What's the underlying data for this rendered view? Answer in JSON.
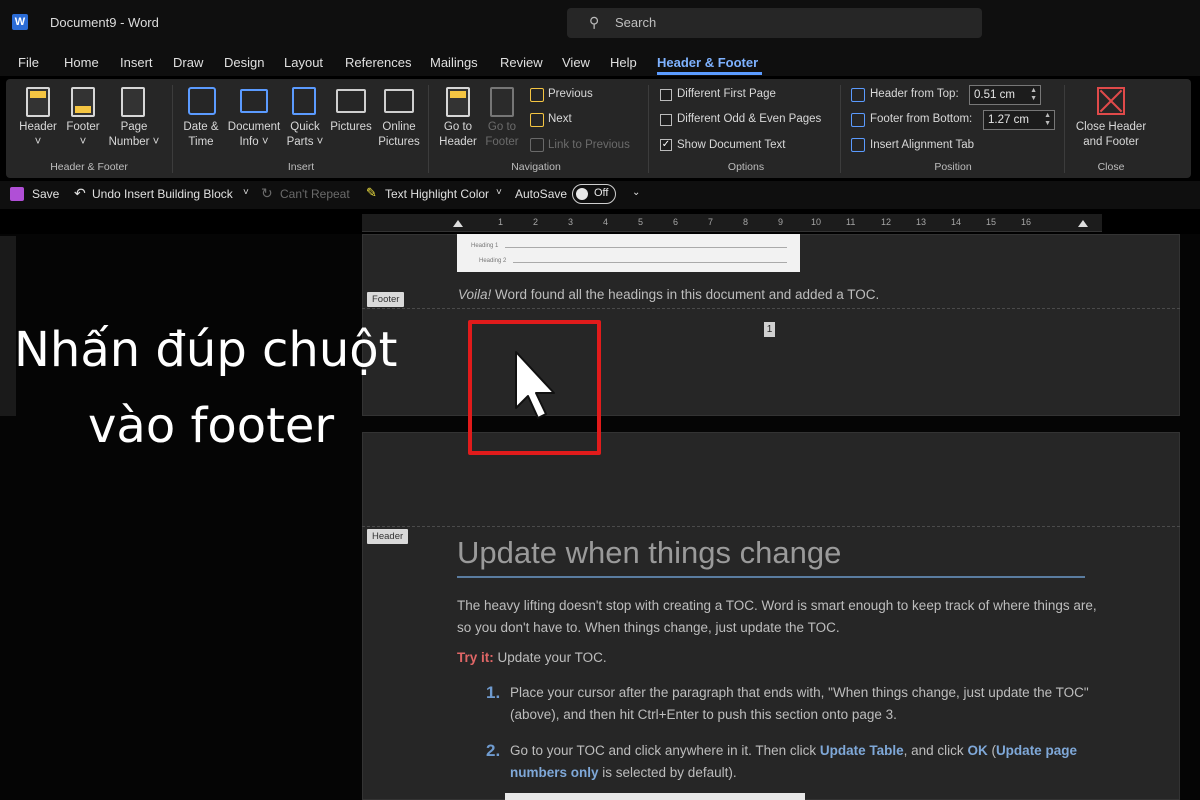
{
  "titlebar": {
    "doc_title": "Document9 - Word",
    "search_placeholder": "Search"
  },
  "menu_tabs": [
    "File",
    "Home",
    "Insert",
    "Draw",
    "Design",
    "Layout",
    "References",
    "Mailings",
    "Review",
    "View",
    "Help",
    "Header & Footer"
  ],
  "active_tab": "Header & Footer",
  "ribbon": {
    "header_footer": {
      "header": "Header",
      "footer": "Footer",
      "page_number_1": "Page",
      "page_number_2": "Number",
      "group": "Header & Footer"
    },
    "insert": {
      "date_1": "Date &",
      "date_2": "Time",
      "docinfo_1": "Document",
      "docinfo_2": "Info",
      "quick_1": "Quick",
      "quick_2": "Parts",
      "pictures": "Pictures",
      "online_1": "Online",
      "online_2": "Pictures",
      "group": "Insert"
    },
    "navigation": {
      "goto_1": "Go to",
      "goto_2": "Header",
      "goto_footer_1": "Go to",
      "goto_footer_2": "Footer",
      "previous": "Previous",
      "next": "Next",
      "link": "Link to Previous",
      "group": "Navigation"
    },
    "options": {
      "diff_first": "Different First Page",
      "diff_odd_even": "Different Odd & Even Pages",
      "show_doc_text": "Show Document Text",
      "group": "Options"
    },
    "position": {
      "header_from_top": "Header from Top:",
      "header_value": "0.51 cm",
      "footer_from_bottom": "Footer from Bottom:",
      "footer_value": "1.27 cm",
      "insert_tab": "Insert Alignment Tab",
      "group": "Position"
    },
    "close": {
      "label_1": "Close Header",
      "label_2": "and Footer",
      "group": "Close"
    }
  },
  "qat": {
    "save": "Save",
    "undo": "Undo Insert Building Block",
    "repeat": "Can't Repeat",
    "highlight": "Text Highlight Color",
    "autosave": "AutoSave",
    "toggle": "Off"
  },
  "ruler_numbers": [
    "1",
    "2",
    "3",
    "4",
    "5",
    "6",
    "7",
    "8",
    "9",
    "10",
    "11",
    "12",
    "13",
    "14",
    "15",
    "16"
  ],
  "document": {
    "toc_line_1": "Heading 1",
    "toc_line_2": "Heading 2",
    "footer_tag": "Footer",
    "voila": "Voila!",
    "voila_rest": " Word found all the headings in this document and added a TOC.",
    "page_number": "1",
    "header_tag": "Header",
    "heading": "Update when things change",
    "para": "The heavy lifting doesn't stop with creating a TOC. Word is smart enough to keep track of where things are, so you don't have to. When things change, just update the TOC.",
    "tryit_label": "Try it:",
    "tryit_text": " Update your TOC.",
    "step1_num": "1.",
    "step1": "Place your cursor after the paragraph that ends with, \"When things change, just update the TOC\" (above), and then hit Ctrl+Enter to push this section onto page 3.",
    "step2_num": "2.",
    "step2_a": "Go to your TOC and click anywhere in it. Then click ",
    "step2_b": "Update Table",
    "step2_c": ", and click ",
    "step2_d": "OK",
    "step2_e": " (",
    "step2_f": "Update page numbers only",
    "step2_g": " is selected by default)."
  },
  "overlay": {
    "line1": "Nhấn đúp chuột",
    "line2": "vào footer"
  },
  "colors": {
    "accent": "#5b9bff",
    "highlight_rect": "#e11b1b",
    "ribbon_bg": "#262626"
  }
}
